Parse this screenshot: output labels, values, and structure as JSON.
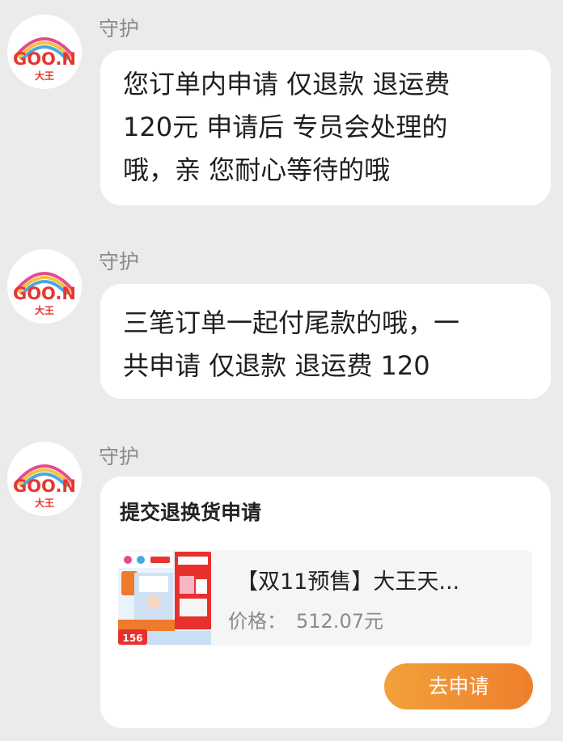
{
  "messages": [
    {
      "sender": "守护",
      "text": "您订单内申请 仅退款 退运费\n120元 申请后 专员会处理的\n哦，亲 您耐心等待的哦"
    },
    {
      "sender": "守护",
      "text": "三笔订单一起付尾款的哦，一\n共申请 仅退款 退运费  120"
    },
    {
      "sender": "守护",
      "card": {
        "title": "提交退换货申请",
        "product_title": "【双11预售】大王天...",
        "price_label": "价格：",
        "price": "512.07元",
        "button_label": "去申请",
        "thumb_price": "156"
      }
    }
  ],
  "avatar": {
    "brand_text": "GOO.N",
    "sub_text": "大王"
  },
  "colors": {
    "background": "#ebebeb",
    "bubble": "#ffffff",
    "sender_name": "#8a8a8a",
    "button_gradient_start": "#f2a13a",
    "button_gradient_end": "#ee7f2c"
  }
}
